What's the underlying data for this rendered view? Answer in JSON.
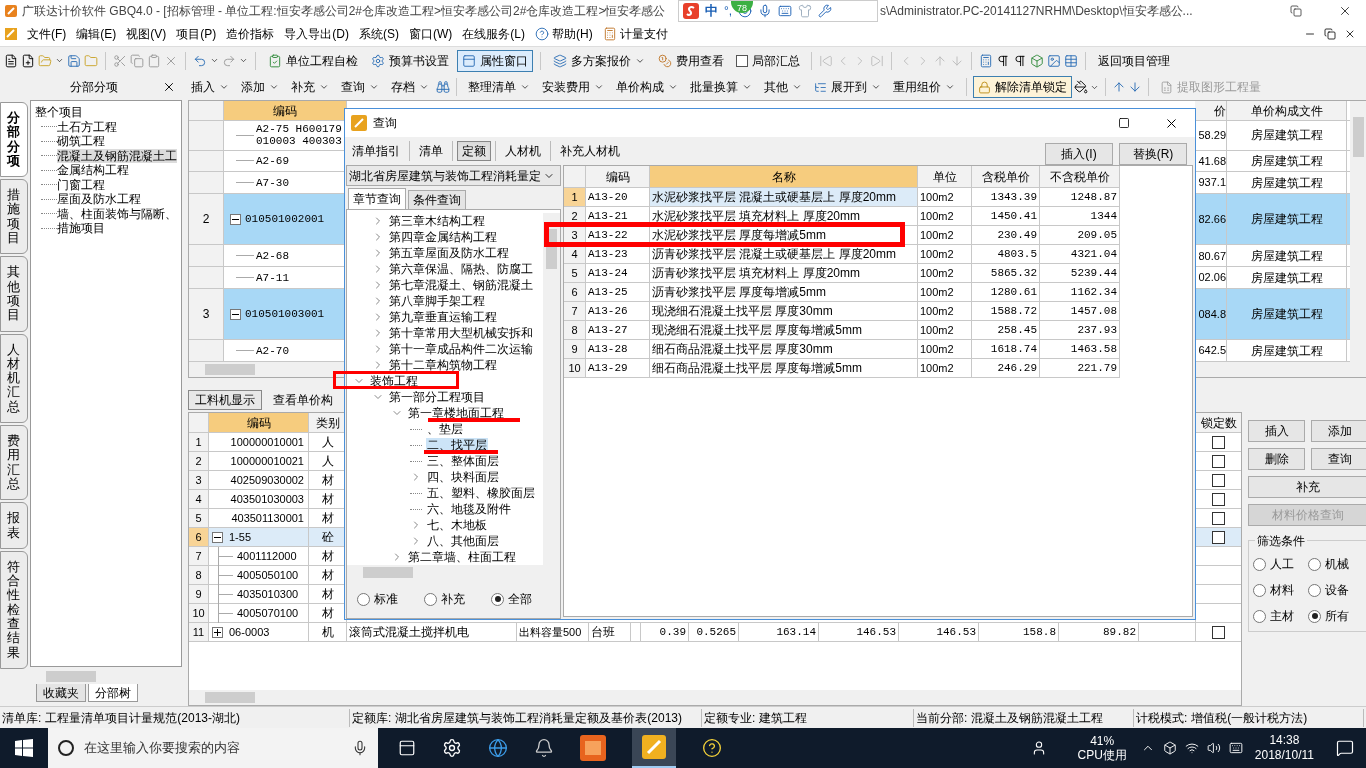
{
  "window": {
    "title_left": "广联达计价软件 GBQ4.0 - [招标管理 - 单位工程:恒安孝感公司2#仓库改造工程>恒安孝感公司2#仓库改造工程>恒安孝感公",
    "title_right": "s\\Administrator.PC-20141127NRHM\\Desktop\\恒安孝感公..."
  },
  "ime": {
    "badge": "78",
    "mode": "中",
    "punct": "°,"
  },
  "menu": [
    {
      "label": "文件(F)",
      "kind": "text"
    },
    {
      "label": "编辑(E)",
      "kind": "text"
    },
    {
      "label": "视图(V)",
      "kind": "text"
    },
    {
      "label": "项目(P)",
      "kind": "text"
    },
    {
      "label": "造价指标",
      "kind": "text"
    },
    {
      "label": "导入导出(D)",
      "kind": "text"
    },
    {
      "label": "系统(S)",
      "kind": "text"
    },
    {
      "label": "窗口(W)",
      "kind": "text"
    },
    {
      "label": "在线服务(L)",
      "kind": "text"
    },
    {
      "label": "帮助(H)",
      "kind": "help"
    },
    {
      "label": "计量支付",
      "kind": "payment"
    }
  ],
  "toolbar": [
    {
      "label": "单位工程自检",
      "kind": "button",
      "selected": false
    },
    {
      "label": "预算书设置",
      "kind": "button",
      "selected": false
    },
    {
      "label": "属性窗口",
      "kind": "button",
      "selected": true
    },
    {
      "label": "多方案报价",
      "kind": "dropdown",
      "selected": false
    },
    {
      "label": "费用查看",
      "kind": "button",
      "selected": false
    },
    {
      "label": "局部汇总",
      "kind": "checkbox",
      "checked": false
    },
    {
      "label": "返回项目管理",
      "kind": "plain",
      "selected": false
    }
  ],
  "pane": {
    "title": "分部分项"
  },
  "actions": [
    {
      "label": "插入",
      "kind": "menu",
      "selected": false,
      "disabled": false
    },
    {
      "label": "添加",
      "kind": "menu",
      "selected": false,
      "disabled": false
    },
    {
      "label": "补充",
      "kind": "menu",
      "selected": false,
      "disabled": false
    },
    {
      "label": "查询",
      "kind": "menu",
      "selected": false,
      "disabled": false
    },
    {
      "label": "存档",
      "kind": "menu",
      "selected": false,
      "disabled": false
    },
    {
      "label": "整理清单",
      "kind": "menu",
      "selected": false,
      "disabled": false
    },
    {
      "label": "安装费用",
      "kind": "menu",
      "selected": false,
      "disabled": false
    },
    {
      "label": "单价构成",
      "kind": "menu",
      "selected": false,
      "disabled": false
    },
    {
      "label": "批量换算",
      "kind": "menu",
      "selected": false,
      "disabled": false
    },
    {
      "label": "其他",
      "kind": "menu",
      "selected": false,
      "disabled": false
    },
    {
      "label": "展开到",
      "kind": "menu",
      "selected": false,
      "disabled": false
    },
    {
      "label": "重用组价",
      "kind": "menu",
      "selected": false,
      "disabled": false
    },
    {
      "label": "解除清单锁定",
      "kind": "button",
      "selected": true,
      "disabled": false
    },
    {
      "label": "提取图形工程量",
      "kind": "button",
      "selected": false,
      "disabled": true
    }
  ],
  "side_tabs": [
    {
      "label": "分部分项",
      "selected": true
    },
    {
      "label": "措施项目",
      "selected": false
    },
    {
      "label": "其他项目",
      "selected": false
    },
    {
      "label": "人材机汇总",
      "selected": false
    },
    {
      "label": "费用汇总",
      "selected": false
    },
    {
      "label": "报表",
      "selected": false
    },
    {
      "label": "符合性检查结果",
      "selected": false
    }
  ],
  "project_tree": {
    "label": "整个项目",
    "selected": false,
    "children": [
      {
        "label": "土石方工程",
        "selected": false
      },
      {
        "label": "砌筑工程",
        "selected": false
      },
      {
        "label": "混凝土及钢筋混凝土工",
        "selected": true
      },
      {
        "label": "金属结构工程",
        "selected": false
      },
      {
        "label": "门窗工程",
        "selected": false
      },
      {
        "label": "屋面及防水工程",
        "selected": false
      },
      {
        "label": "墙、柱面装饰与隔断、",
        "selected": false
      },
      {
        "label": "措施项目",
        "selected": false
      }
    ]
  },
  "tree_tabs": [
    {
      "label": "收藏夹",
      "selected": false
    },
    {
      "label": "分部树",
      "selected": true
    }
  ],
  "bill_table": {
    "columns": [
      {
        "label": "编码",
        "active": true
      },
      {
        "label": "价",
        "active": false
      },
      {
        "label": "单价构成文件",
        "active": false
      }
    ],
    "rows": [
      {
        "children": [
          {
            "code": "A2-75 H600179 010003 400303",
            "price": "58.29",
            "file": "房屋建筑工程"
          },
          {
            "code": "A2-69",
            "price": "41.68",
            "file": "房屋建筑工程"
          },
          {
            "code": "A7-30",
            "price": "937.1",
            "file": "房屋建筑工程"
          }
        ]
      },
      {
        "no": "2",
        "code": "010501002001",
        "price": "82.66",
        "file": "房屋建筑工程",
        "expanded": true,
        "children": [
          {
            "code": "A2-68",
            "price": "80.67",
            "file": "房屋建筑工程"
          },
          {
            "code": "A7-11",
            "price": "02.06",
            "file": "房屋建筑工程"
          }
        ]
      },
      {
        "no": "3",
        "code": "010501003001",
        "price": "084.8",
        "file": "房屋建筑工程",
        "expanded": true,
        "children": [
          {
            "code": "A2-70",
            "price": "642.5",
            "file": "房屋建筑工程"
          }
        ]
      }
    ]
  },
  "lower_tabs": [
    {
      "label": "工料机显示",
      "selected": true
    },
    {
      "label": "查看单价构",
      "selected": false
    }
  ],
  "resource_table": {
    "columns": {
      "code": "编码",
      "type": "类别",
      "lock": "锁定数"
    },
    "rows": [
      {
        "no": "1",
        "code": "100000010001",
        "type": "人",
        "selected": false,
        "lock_checked": false
      },
      {
        "no": "2",
        "code": "100000010021",
        "type": "人",
        "selected": false,
        "lock_checked": false
      },
      {
        "no": "3",
        "code": "402509030002",
        "type": "材",
        "selected": false,
        "lock_checked": false
      },
      {
        "no": "4",
        "code": "403501030003",
        "type": "材",
        "selected": false,
        "lock_checked": false
      },
      {
        "no": "5",
        "code": "403501130001",
        "type": "材",
        "selected": false,
        "lock_checked": false
      },
      {
        "no": "6",
        "code": "1-55",
        "type": "砼",
        "selected": true,
        "expanded": true,
        "lock_checked": false,
        "children": [
          {
            "no": "7",
            "code": "4001112000",
            "type": "材",
            "selected": false
          },
          {
            "no": "8",
            "code": "4005050100",
            "type": "材",
            "selected": false
          },
          {
            "no": "9",
            "code": "4035010300",
            "type": "材",
            "selected": false
          },
          {
            "no": "10",
            "code": "4005070100",
            "type": "材",
            "selected": false
          }
        ]
      },
      {
        "no": "11",
        "code": "06-0003",
        "type": "机",
        "selected": false,
        "expanded": false,
        "lock_checked": false,
        "name": "滚筒式混凝土搅拌机电",
        "spec": "出料容量500",
        "unit": "台班",
        "values": [
          "0.39",
          "0.5265",
          "163.14",
          "146.53",
          "146.53",
          "158.8",
          "89.82"
        ]
      }
    ]
  },
  "side_buttons": [
    {
      "label": "插入",
      "disabled": false
    },
    {
      "label": "添加",
      "disabled": false
    },
    {
      "label": "删除",
      "disabled": false
    },
    {
      "label": "查询",
      "disabled": false
    },
    {
      "label": "补充",
      "disabled": false
    },
    {
      "label": "材料价格查询",
      "disabled": true
    }
  ],
  "filter": {
    "title": "筛选条件",
    "options": [
      {
        "label": "人工",
        "selected": false
      },
      {
        "label": "机械",
        "selected": false
      },
      {
        "label": "材料",
        "selected": false
      },
      {
        "label": "设备",
        "selected": false
      },
      {
        "label": "主材",
        "selected": false
      },
      {
        "label": "所有",
        "selected": true
      }
    ]
  },
  "dialog": {
    "title": "查询",
    "tabs": [
      {
        "label": "清单指引",
        "selected": false
      },
      {
        "label": "清单",
        "selected": false
      },
      {
        "label": "定额",
        "selected": true
      },
      {
        "label": "人材机",
        "selected": false
      },
      {
        "label": "补充人材机",
        "selected": false
      }
    ],
    "actions": [
      "插入(I)",
      "替换(R)"
    ],
    "library": "湖北省房屋建筑与装饰工程消耗量定",
    "search_tabs": [
      {
        "label": "章节查询",
        "selected": true
      },
      {
        "label": "条件查询",
        "selected": false
      }
    ],
    "tree": [
      {
        "children": [
          {
            "label": "第三章木结构工程",
            "kind": "folder",
            "expanded": false,
            "selected": false
          },
          {
            "label": "第四章金属结构工程",
            "kind": "folder",
            "expanded": false,
            "selected": false
          },
          {
            "label": "第五章屋面及防水工程",
            "kind": "folder",
            "expanded": false,
            "selected": false
          },
          {
            "label": "第六章保温、隔热、防腐工",
            "kind": "folder",
            "expanded": false,
            "selected": false
          },
          {
            "label": "第七章混凝土、钢筋混凝土",
            "kind": "folder",
            "expanded": false,
            "selected": false
          },
          {
            "label": "第八章脚手架工程",
            "kind": "folder",
            "expanded": false,
            "selected": false
          },
          {
            "label": "第九章垂直运输工程",
            "kind": "folder",
            "expanded": false,
            "selected": false
          },
          {
            "label": "第十章常用大型机械安拆和",
            "kind": "folder",
            "expanded": false,
            "selected": false
          },
          {
            "label": "第十一章成品构件二次运输",
            "kind": "folder",
            "expanded": false,
            "selected": false
          },
          {
            "label": "第十二章构筑物工程",
            "kind": "folder",
            "expanded": false,
            "selected": false
          }
        ]
      },
      {
        "label": "装饰工程",
        "kind": "folder",
        "expanded": true,
        "selected": false,
        "children": [
          {
            "label": "第一部分工程项目",
            "kind": "folder",
            "expanded": true,
            "selected": false,
            "children": [
              {
                "label": "第一章楼地面工程",
                "kind": "folder",
                "expanded": true,
                "selected": false,
                "children": [
                  {
                    "label": "、垫层",
                    "kind": "leaf",
                    "selected": false
                  },
                  {
                    "label": "二、找平层",
                    "kind": "leaf",
                    "selected": true
                  },
                  {
                    "label": "三、整体面层",
                    "kind": "leaf",
                    "selected": false
                  },
                  {
                    "label": "四、块料面层",
                    "kind": "folder",
                    "expanded": false,
                    "selected": false
                  },
                  {
                    "label": "五、塑料、橡胶面层",
                    "kind": "leaf",
                    "selected": false
                  },
                  {
                    "label": "六、地毯及附件",
                    "kind": "leaf",
                    "selected": false
                  },
                  {
                    "label": "七、木地板",
                    "kind": "folder",
                    "expanded": false,
                    "selected": false
                  },
                  {
                    "label": "八、其他面层",
                    "kind": "folder",
                    "expanded": false,
                    "selected": false
                  }
                ]
              },
              {
                "label": "第二章墙、柱面工程",
                "kind": "folder",
                "expanded": false,
                "selected": false
              }
            ]
          }
        ]
      }
    ],
    "scope": [
      {
        "label": "标准",
        "selected": false
      },
      {
        "label": "补充",
        "selected": false
      },
      {
        "label": "全部",
        "selected": true
      }
    ],
    "columns": [
      {
        "label": "编码",
        "active": false
      },
      {
        "label": "名称",
        "active": true
      },
      {
        "label": "单位",
        "active": false
      },
      {
        "label": "含税单价",
        "active": false
      },
      {
        "label": "不含税单价",
        "active": false
      }
    ],
    "rows": [
      {
        "no": "1",
        "code": "A13-20",
        "name": "水泥砂浆找平层 混凝土或硬基层上 厚度20mm",
        "unit": "100m2",
        "tax_price": "1343.39",
        "price": "1248.87",
        "selected": true
      },
      {
        "no": "2",
        "code": "A13-21",
        "name": "水泥砂浆找平层 填充材料上 厚度20mm",
        "unit": "100m2",
        "tax_price": "1450.41",
        "price": "1344",
        "selected": false
      },
      {
        "no": "3",
        "code": "A13-22",
        "name": "水泥砂浆找平层 厚度每增减5mm",
        "unit": "100m2",
        "tax_price": "230.49",
        "price": "209.05",
        "selected": false
      },
      {
        "no": "4",
        "code": "A13-23",
        "name": "沥青砂浆找平层 混凝土或硬基层上 厚度20mm",
        "unit": "100m2",
        "tax_price": "4803.5",
        "price": "4321.04",
        "selected": false
      },
      {
        "no": "5",
        "code": "A13-24",
        "name": "沥青砂浆找平层 填充材料上 厚度20mm",
        "unit": "100m2",
        "tax_price": "5865.32",
        "price": "5239.44",
        "selected": false
      },
      {
        "no": "6",
        "code": "A13-25",
        "name": "沥青砂浆找平层 厚度每增减5mm",
        "unit": "100m2",
        "tax_price": "1280.61",
        "price": "1162.34",
        "selected": false
      },
      {
        "no": "7",
        "code": "A13-26",
        "name": "现浇细石混凝土找平层 厚度30mm",
        "unit": "100m2",
        "tax_price": "1588.72",
        "price": "1457.08",
        "selected": false
      },
      {
        "no": "8",
        "code": "A13-27",
        "name": "现浇细石混凝土找平层 厚度每增减5mm",
        "unit": "100m2",
        "tax_price": "258.45",
        "price": "237.93",
        "selected": false
      },
      {
        "no": "9",
        "code": "A13-28",
        "name": "细石商品混凝土找平层 厚度30mm",
        "unit": "100m2",
        "tax_price": "1618.74",
        "price": "1463.58",
        "selected": false
      },
      {
        "no": "10",
        "code": "A13-29",
        "name": "细石商品混凝土找平层 厚度每增减5mm",
        "unit": "100m2",
        "tax_price": "246.29",
        "price": "221.79",
        "selected": false
      }
    ]
  },
  "status_bar": [
    {
      "label": "清单库:",
      "value": "工程量清单项目计量规范(2013-湖北)"
    },
    {
      "label": "定额库:",
      "value": "湖北省房屋建筑与装饰工程消耗量定额及基价表(2013)"
    },
    {
      "label": "定额专业:",
      "value": "建筑工程"
    },
    {
      "label": "当前分部:",
      "value": "混凝土及钢筋混凝土工程"
    },
    {
      "label": "计税模式:",
      "value": "增值税(一般计税方法)"
    }
  ],
  "taskbar": {
    "search": {
      "placeholder": "在这里输入你要搜索的内容"
    },
    "cpu": "41%",
    "cpu_label": "CPU使用",
    "time": "14:38",
    "date": "2018/10/11"
  }
}
